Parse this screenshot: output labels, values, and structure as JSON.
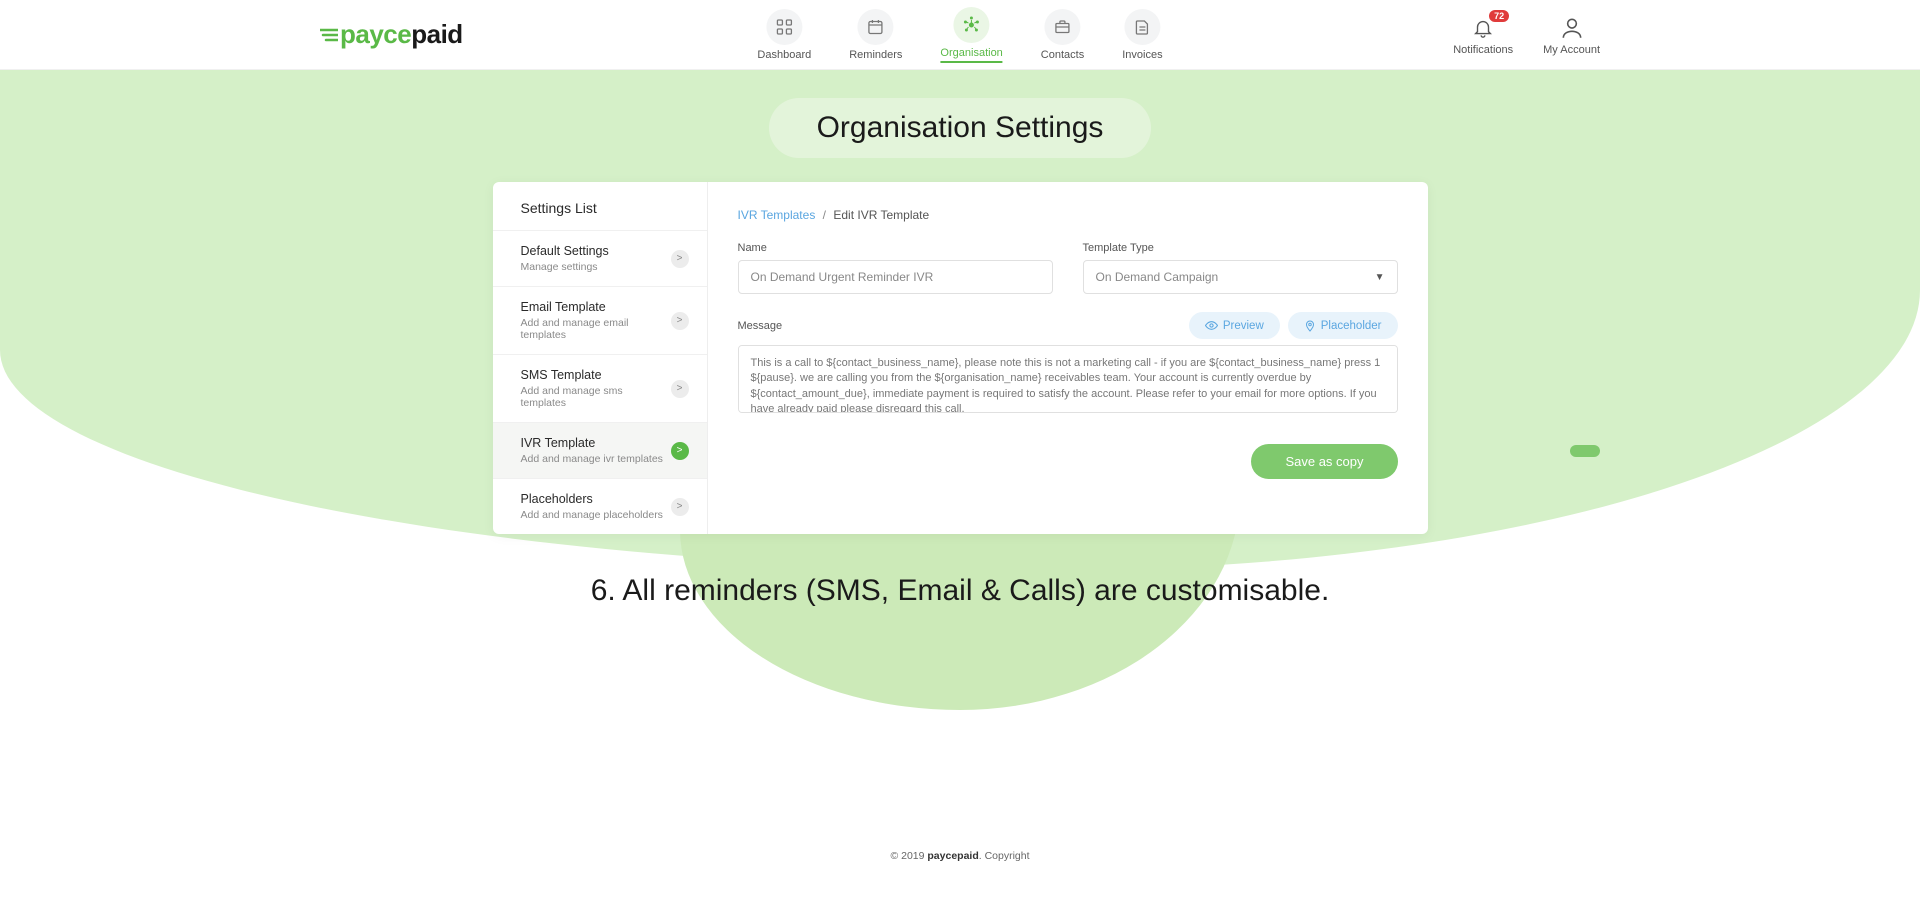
{
  "header": {
    "logo_green": "payce",
    "logo_black": "paid",
    "nav": [
      {
        "label": "Dashboard"
      },
      {
        "label": "Reminders"
      },
      {
        "label": "Organisation"
      },
      {
        "label": "Contacts"
      },
      {
        "label": "Invoices"
      }
    ],
    "notifications_label": "Notifications",
    "notifications_count": "72",
    "account_label": "My Account"
  },
  "page_title": "Organisation Settings",
  "sidebar": {
    "header": "Settings List",
    "items": [
      {
        "title": "Default Settings",
        "sub": "Manage settings"
      },
      {
        "title": "Email Template",
        "sub": "Add and manage email templates"
      },
      {
        "title": "SMS Template",
        "sub": "Add and manage sms templates"
      },
      {
        "title": "IVR Template",
        "sub": "Add and manage ivr templates"
      },
      {
        "title": "Placeholders",
        "sub": "Add and manage placeholders"
      }
    ]
  },
  "breadcrumb": {
    "link": "IVR Templates",
    "current": "Edit IVR Template"
  },
  "form": {
    "name_label": "Name",
    "name_value": "On Demand Urgent Reminder IVR",
    "type_label": "Template Type",
    "type_value": "On Demand Campaign",
    "message_label": "Message",
    "preview_btn": "Preview",
    "placeholder_btn": "Placeholder",
    "message_value": "This is a call to ${contact_business_name}, please note this is not a marketing call - if you are ${contact_business_name} press 1 ${pause}. we are calling you from the ${organisation_name} receivables team. Your account is currently overdue by ${contact_amount_due}, immediate payment is required to satisfy the account. Please refer to your email for more options. If you have already paid please disregard this call.\nThank you.",
    "save_btn": "Save as copy"
  },
  "caption": "6. All reminders (SMS, Email & Calls) are customisable.",
  "footer": {
    "pre": "© 2019 ",
    "brand": "paycepaid",
    "post": ". Copyright"
  }
}
